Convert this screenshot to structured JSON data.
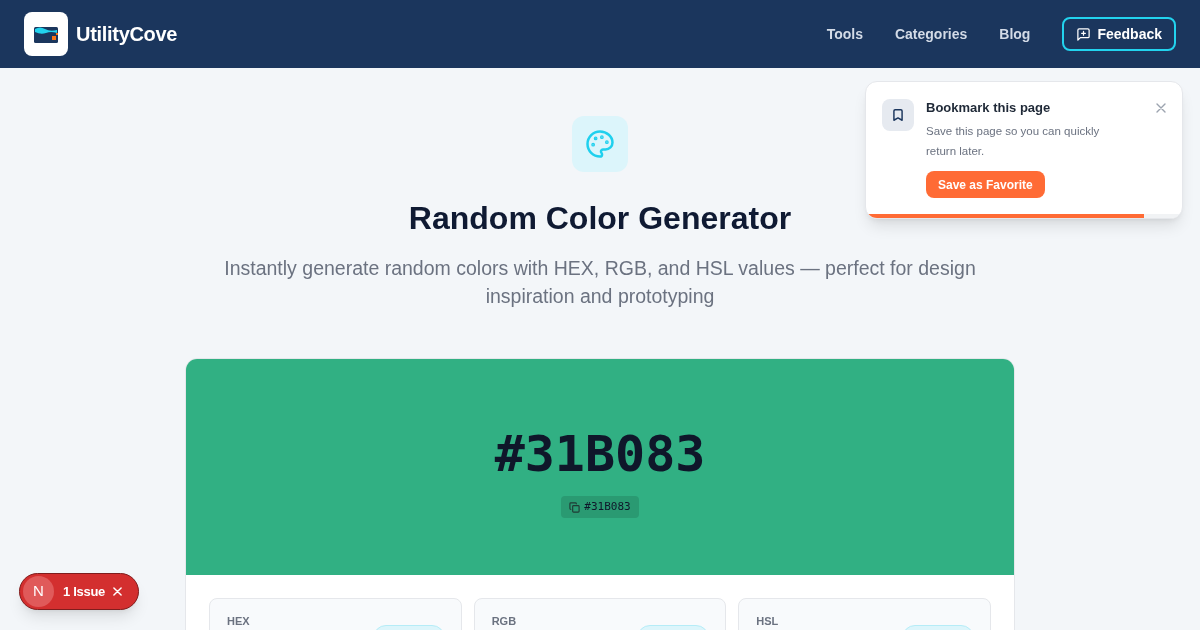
{
  "header": {
    "brand": "UtilityCove",
    "nav": [
      {
        "label": "Tools"
      },
      {
        "label": "Categories"
      },
      {
        "label": "Blog"
      }
    ],
    "feedback_button": "Feedback"
  },
  "hero": {
    "title": "Random Color Generator",
    "subtitle": "Instantly generate random colors with HEX, RGB, and HSL values — perfect for design inspiration and prototyping"
  },
  "color_preview": {
    "color": "#31b083",
    "hex": "#31B083",
    "copy_chip": "#31B083"
  },
  "value_cards": [
    {
      "label": "HEX"
    },
    {
      "label": "RGB"
    },
    {
      "label": "HSL"
    }
  ],
  "toast": {
    "title": "Bookmark this page",
    "message": "Save this page so you can quickly return later.",
    "button": "Save as Favorite",
    "level": 0.88
  },
  "issues_badge": {
    "letter": "N",
    "label": "1 Issue"
  }
}
